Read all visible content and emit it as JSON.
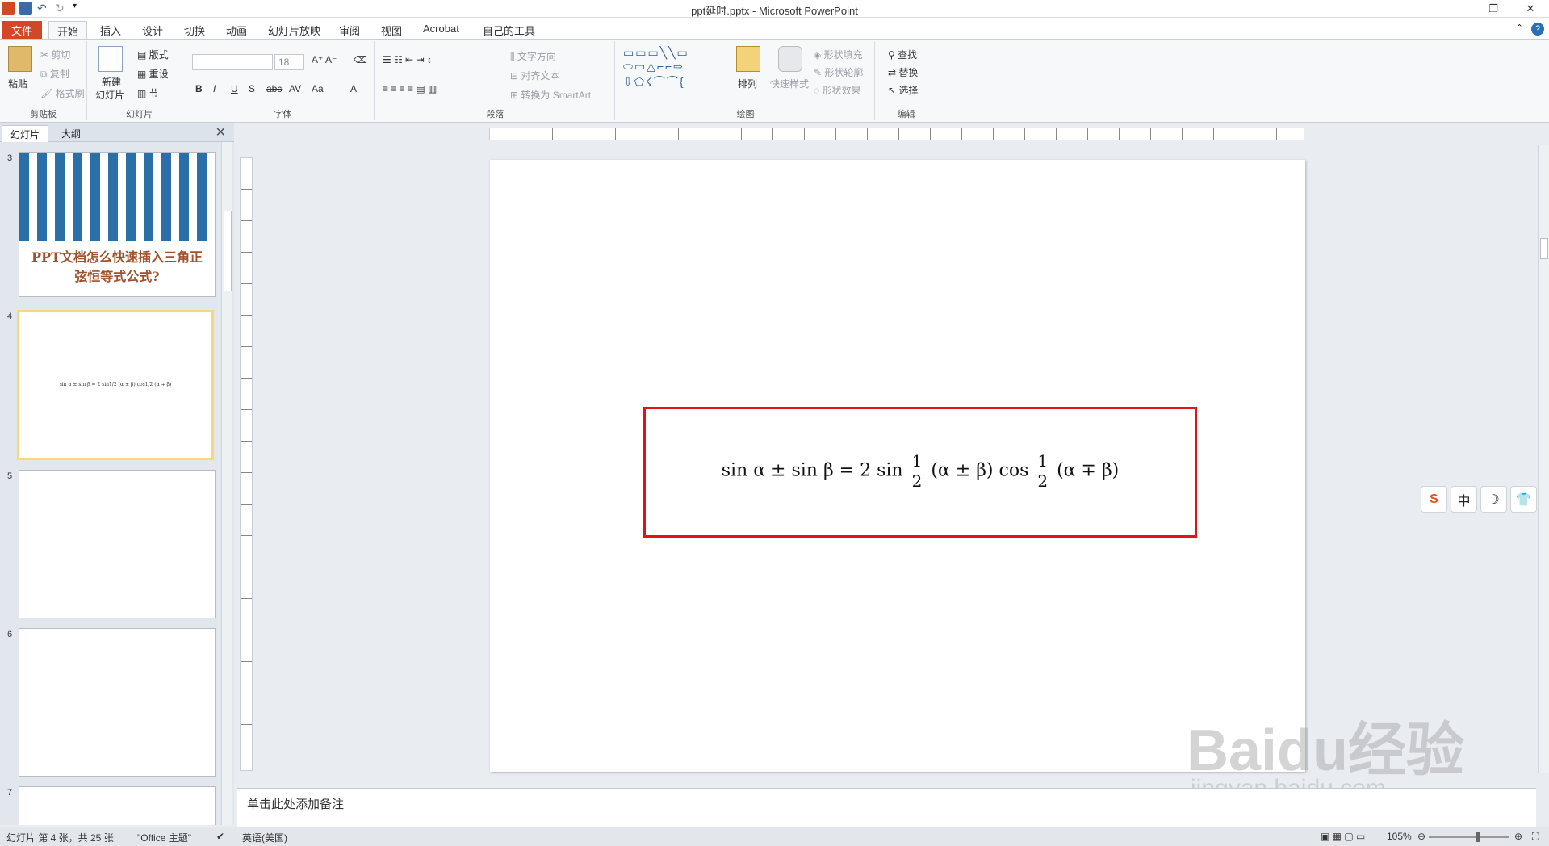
{
  "window": {
    "title": "ppt延时.pptx - Microsoft PowerPoint"
  },
  "tabs": [
    "文件",
    "开始",
    "插入",
    "设计",
    "切换",
    "动画",
    "幻灯片放映",
    "审阅",
    "视图",
    "Acrobat",
    "自己的工具"
  ],
  "ribbon": {
    "clipboard": {
      "paste": "粘贴",
      "cut": "剪切",
      "copy": "复制",
      "format_painter": "格式刷",
      "label": "剪贴板"
    },
    "slides": {
      "new_slide": "新建",
      "new_slide2": "幻灯片",
      "layout": "版式",
      "reset": "重设",
      "section": "节",
      "label": "幻灯片"
    },
    "font": {
      "size": "18",
      "label": "字体"
    },
    "paragraph": {
      "text_direction": "文字方向",
      "align_text": "对齐文本",
      "smartart": "转换为 SmartArt",
      "label": "段落"
    },
    "drawing": {
      "arrange": "排列",
      "quick_styles": "快速样式",
      "shape_fill": "形状填充",
      "shape_outline": "形状轮廓",
      "shape_effects": "形状效果",
      "label": "绘图"
    },
    "editing": {
      "find": "查找",
      "replace": "替换",
      "select": "选择",
      "label": "编辑"
    }
  },
  "left_pane": {
    "tab_slides": "幻灯片",
    "tab_outline": "大纲",
    "slide3_title": "PPT文档怎么快速插入三角正弦恒等式公式?",
    "slide_numbers": [
      "3",
      "4",
      "5",
      "6",
      "7"
    ]
  },
  "slide": {
    "formula_prefix": "sin α ± sin β = 2 sin",
    "frac_num": "1",
    "frac_den": "2",
    "formula_mid": "(α ± β) cos",
    "formula_suffix": "(α ∓ β)"
  },
  "ime": {
    "zhong": "中"
  },
  "notes": {
    "placeholder": "单击此处添加备注"
  },
  "status": {
    "slide_info": "幻灯片 第 4 张，共 25 张",
    "theme": "\"Office 主题\"",
    "language": "英语(美国)",
    "zoom": "105%"
  },
  "watermark": {
    "main": "Baidu经验",
    "sub": "jingyan.baidu.com"
  },
  "colors": {
    "file_tab": "#d24726",
    "formula_border": "#e31313",
    "selected_thumb": "#f5d97a"
  }
}
